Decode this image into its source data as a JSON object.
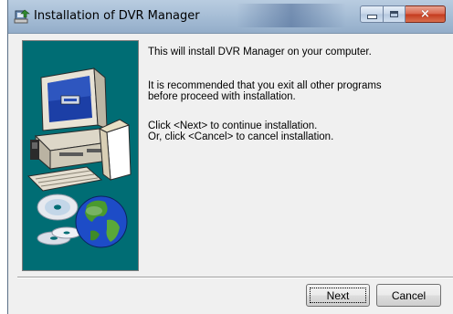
{
  "window": {
    "title": "Installation of DVR Manager",
    "controls": {
      "minimize": "minimize",
      "maximize": "maximize",
      "close": "×"
    }
  },
  "messages": {
    "line1": "This will install DVR Manager on your computer.",
    "line2": "It is recommended that you exit all other programs",
    "line3": "before proceed with installation.",
    "line4": "Click <Next> to continue installation.",
    "line5": "Or, click <Cancel> to cancel installation."
  },
  "buttons": {
    "next": "Next",
    "cancel": "Cancel"
  },
  "colors": {
    "graphic_panel": "#006d74",
    "titlebar": "#a8bfd7",
    "close_button": "#c3391d"
  },
  "icons": [
    "installer-icon",
    "minimize-icon",
    "maximize-icon",
    "close-icon",
    "computer-illustration",
    "cd-illustration",
    "globe-illustration"
  ]
}
